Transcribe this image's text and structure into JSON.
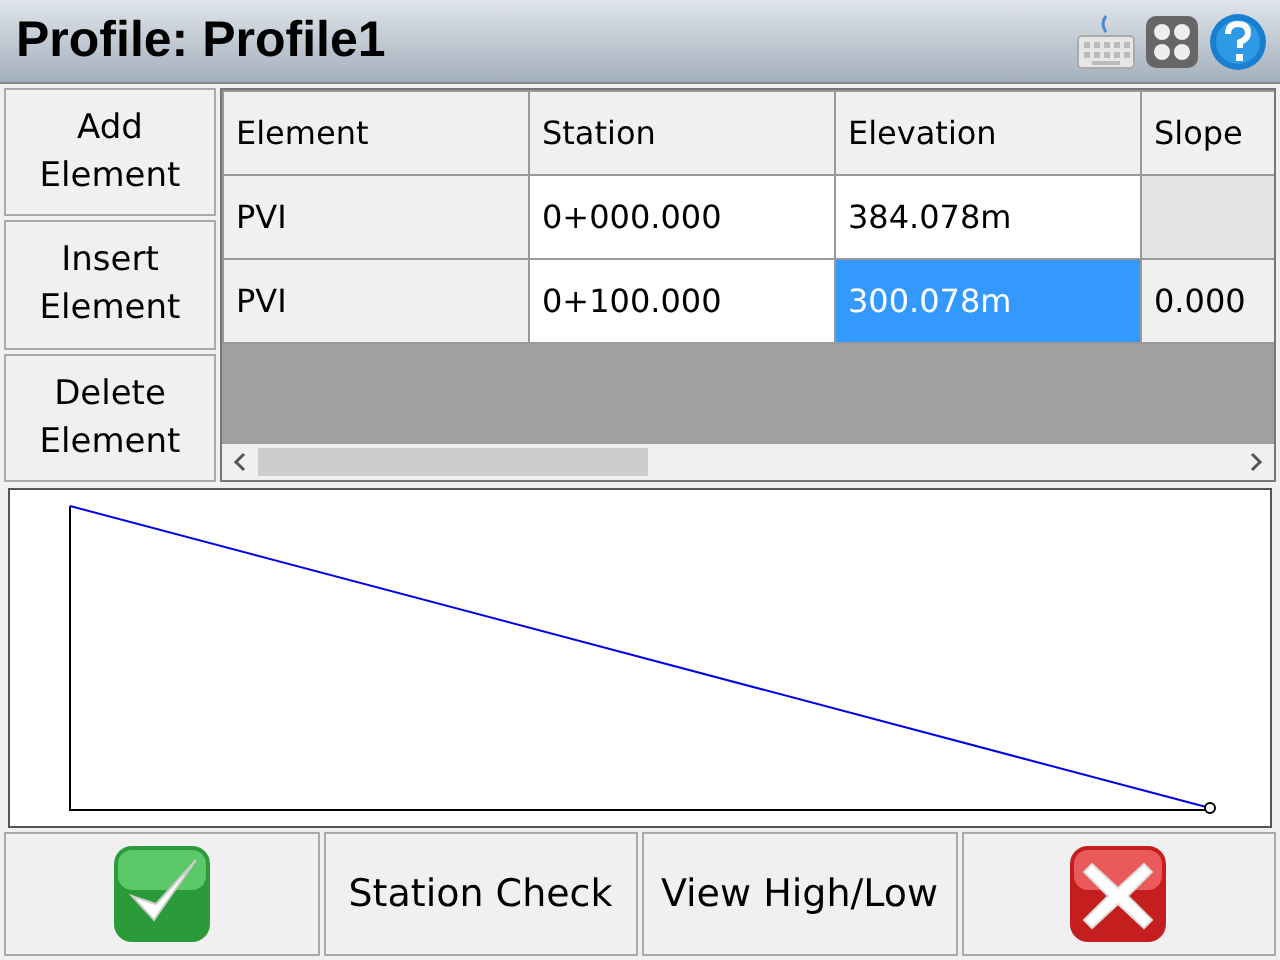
{
  "window": {
    "title": "Profile: Profile1"
  },
  "side_buttons": [
    "Add Element",
    "Insert Element",
    "Delete Element"
  ],
  "table": {
    "columns": [
      "Element",
      "Station",
      "Elevation",
      "Slope"
    ],
    "rows": [
      {
        "cells": [
          {
            "text": "PVI",
            "selected": false
          },
          {
            "text": "0+000.000",
            "selected": false
          },
          {
            "text": "384.078m",
            "selected": false
          }
        ]
      },
      {
        "cells": [
          {
            "text": "PVI",
            "selected": false
          },
          {
            "text": "0+100.000",
            "selected": false
          },
          {
            "text": "300.078m",
            "selected": true
          },
          {
            "text": "0.000",
            "selected": false
          }
        ]
      }
    ]
  },
  "bottom_buttons": [
    {
      "kind": "accept"
    },
    {
      "kind": "text",
      "label": "Station Check"
    },
    {
      "kind": "text",
      "label": "View High/Low"
    },
    {
      "kind": "cancel"
    }
  ]
}
